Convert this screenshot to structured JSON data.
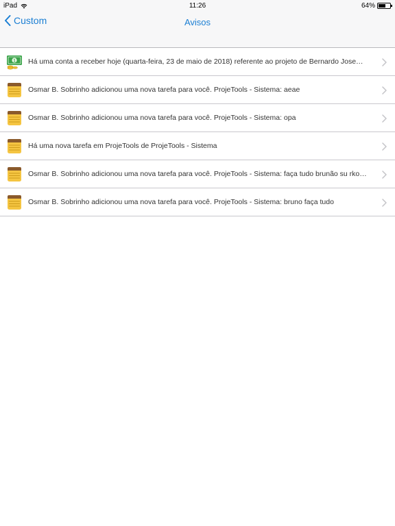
{
  "status_bar": {
    "carrier": "iPad",
    "time": "11:26",
    "battery_text": "64%",
    "battery_level": 0.64
  },
  "nav": {
    "back_label": "Custom",
    "title": "Avisos"
  },
  "notifications": [
    {
      "icon": "money-icon",
      "text": "Há uma conta a receber hoje (quarta-feira, 23 de maio de 2018) referente ao projeto de Bernardo Jose…"
    },
    {
      "icon": "notepad-icon",
      "text": "Osmar B. Sobrinho adicionou uma nova tarefa para você. ProjeTools - Sistema: aeae"
    },
    {
      "icon": "notepad-icon",
      "text": "Osmar B. Sobrinho adicionou uma nova tarefa para você. ProjeTools - Sistema: opa"
    },
    {
      "icon": "notepad-icon",
      "text": "Há uma nova tarefa em ProjeTools  de ProjeTools - Sistema"
    },
    {
      "icon": "notepad-icon",
      "text": "Osmar B. Sobrinho adicionou uma nova tarefa para você. ProjeTools - Sistema: faça tudo brunão su rko…"
    },
    {
      "icon": "notepad-icon",
      "text": "Osmar B. Sobrinho adicionou uma nova tarefa para você. ProjeTools - Sistema: bruno faça tudo"
    }
  ],
  "colors": {
    "accent": "#1a7ed3",
    "money_green": "#3aa34a",
    "notepad_yellow": "#f5c542"
  }
}
